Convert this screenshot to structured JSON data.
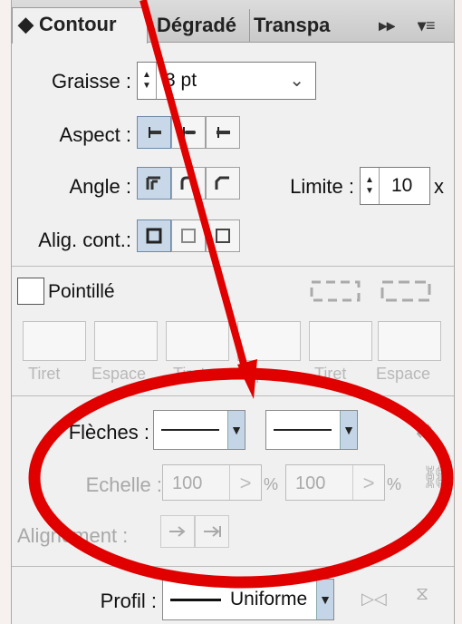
{
  "tabs": [
    "◆ Contour",
    "Dégradé",
    "Transpa"
  ],
  "menu": [
    "▸▸",
    "▾≡"
  ],
  "weight": {
    "label": "Graisse :",
    "value": "3 pt"
  },
  "cap": {
    "label": "Aspect :"
  },
  "corner": {
    "label": "Angle :"
  },
  "limit": {
    "label": "Limite :",
    "value": "10",
    "unit": "x"
  },
  "align": {
    "label": "Alig. cont.:"
  },
  "dashed": {
    "label": "Pointillé",
    "fields": [
      "Tiret",
      "Espace",
      "Tiret",
      "Espace",
      "Tiret",
      "Espace"
    ]
  },
  "arrows": {
    "label": "Flèches :",
    "scale_label": "Echelle :",
    "scale1": "100",
    "scale2": "100",
    "pct": "%",
    "alignment_label": "Alignement :"
  },
  "profile": {
    "label": "Profil :",
    "value": "Uniforme"
  },
  "colors": {
    "annotation": "#e00000"
  }
}
